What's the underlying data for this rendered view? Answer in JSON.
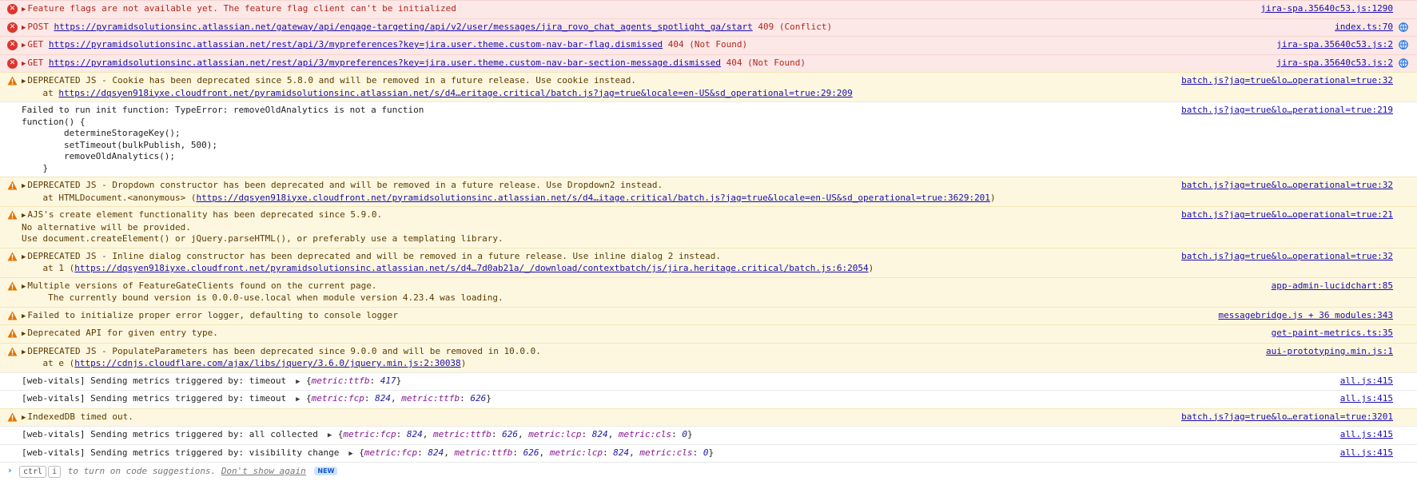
{
  "rows": [
    {
      "level": "error",
      "msg": "Feature flags are not available yet. The feature flag client can't be initialized",
      "source": "jira-spa.35640c53.js:1290"
    },
    {
      "level": "error",
      "method": "POST",
      "url": "https://pyramidsolutionsinc.atlassian.net/gateway/api/engage-targeting/api/v2/user/messages/jira_rovo_chat_agents_spotlight_ga/start",
      "status": "409 (Conflict)",
      "source": "index.ts:70"
    },
    {
      "level": "error",
      "method": "GET",
      "url": "https://pyramidsolutionsinc.atlassian.net/rest/api/3/mypreferences?key=jira.user.theme.custom-nav-bar-flag.dismissed",
      "status": "404 (Not Found)",
      "source": "jira-spa.35640c53.js:2"
    },
    {
      "level": "error",
      "method": "GET",
      "url": "https://pyramidsolutionsinc.atlassian.net/rest/api/3/mypreferences?key=jira.user.theme.custom-nav-bar-section-message.dismissed",
      "status": "404 (Not Found)",
      "source": "jira-spa.35640c53.js:2"
    },
    {
      "level": "warning",
      "msg": "DEPRECATED JS - Cookie has been deprecated since 5.8.0 and will be removed in a future release. Use cookie instead.",
      "at_prefix": "    at ",
      "at_url": "https://dqsyen918iyxe.cloudfront.net/pyramidsolutionsinc.atlassian.net/s/d4…eritage.critical/batch.js?jag=true&locale=en-US&sd_operational=true:29:209",
      "at_suffix": "",
      "source": "batch.js?jag=true&lo…operational=true:32"
    },
    {
      "level": "info",
      "msg": "Failed to run init function: TypeError: removeOldAnalytics is not a function\nfunction() {\n        determineStorageKey();\n        setTimeout(bulkPublish, 500);\n        removeOldAnalytics();\n    }",
      "source": "batch.js?jag=true&lo…perational=true:219"
    },
    {
      "level": "warning",
      "msg": "DEPRECATED JS - Dropdown constructor has been deprecated and will be removed in a future release. Use Dropdown2 instead.",
      "at_prefix": "    at HTMLDocument.<anonymous> (",
      "at_url": "https://dqsyen918iyxe.cloudfront.net/pyramidsolutionsinc.atlassian.net/s/d4…itage.critical/batch.js?jag=true&locale=en-US&sd_operational=true:3629:201",
      "at_suffix": ")",
      "source": "batch.js?jag=true&lo…operational=true:32"
    },
    {
      "level": "warning",
      "msg": "AJS's create element functionality has been deprecated since 5.9.0.\nNo alternative will be provided.\nUse document.createElement() or jQuery.parseHTML(), or preferably use a templating library.",
      "source": "batch.js?jag=true&lo…operational=true:21"
    },
    {
      "level": "warning",
      "msg": "DEPRECATED JS - Inline dialog constructor has been deprecated and will be removed in a future release. Use inline dialog 2 instead.",
      "at_prefix": "    at 1 (",
      "at_url": "https://dqsyen918iyxe.cloudfront.net/pyramidsolutionsinc.atlassian.net/s/d4…7d0ab21a/_/download/contextbatch/js/jira.heritage.critical/batch.js:6:2054",
      "at_suffix": ")",
      "source": "batch.js?jag=true&lo…operational=true:32"
    },
    {
      "level": "warning",
      "msg": "Multiple versions of FeatureGateClients found on the current page.\n     The currently bound version is 0.0.0-use.local when module version 4.23.4 was loading.",
      "source": "app-admin-lucidchart:85"
    },
    {
      "level": "warning",
      "msg": "Failed to initialize proper error logger, defaulting to console logger",
      "source": "messagebridge.js + 36 modules:343"
    },
    {
      "level": "warning",
      "msg": "Deprecated API for given entry type.",
      "source": "get-paint-metrics.ts:35"
    },
    {
      "level": "warning",
      "msg": "DEPRECATED JS - PopulateParameters has been deprecated since 9.0.0 and will be removed in 10.0.0.",
      "at_prefix": "    at e (",
      "at_url": "https://cdnjs.cloudflare.com/ajax/libs/jquery/3.6.0/jquery.min.js:2:30038",
      "at_suffix": ")",
      "source": "aui-prototyping.min.js:1"
    },
    {
      "level": "info",
      "msg": "[web-vitals] Sending metrics triggered by: timeout ",
      "obj": [
        [
          "metric:ttfb",
          "417"
        ]
      ],
      "source": "all.js:415"
    },
    {
      "level": "info",
      "msg": "[web-vitals] Sending metrics triggered by: timeout ",
      "obj": [
        [
          "metric:fcp",
          "824"
        ],
        [
          "metric:ttfb",
          "626"
        ]
      ],
      "source": "all.js:415"
    },
    {
      "level": "warning",
      "msg": "IndexedDB timed out.",
      "source": "batch.js?jag=true&lo…erational=true:3201"
    },
    {
      "level": "info",
      "msg": "[web-vitals] Sending metrics triggered by: all collected ",
      "obj": [
        [
          "metric:fcp",
          "824"
        ],
        [
          "metric:ttfb",
          "626"
        ],
        [
          "metric:lcp",
          "824"
        ],
        [
          "metric:cls",
          "0"
        ]
      ],
      "source": "all.js:415"
    },
    {
      "level": "info",
      "msg": "[web-vitals] Sending metrics triggered by: visibility change ",
      "obj": [
        [
          "metric:fcp",
          "824"
        ],
        [
          "metric:ttfb",
          "626"
        ],
        [
          "metric:lcp",
          "824"
        ],
        [
          "metric:cls",
          "0"
        ]
      ],
      "source": "all.js:415"
    }
  ],
  "prompt": {
    "key1": "ctrl",
    "key2": "i",
    "hint": "to turn on code suggestions.",
    "dont_show": "Don't show again",
    "badge": "NEW"
  },
  "colors": {
    "error_bg": "#fce8e6",
    "warning_bg": "#fef7e0",
    "link": "#1a0dab"
  }
}
